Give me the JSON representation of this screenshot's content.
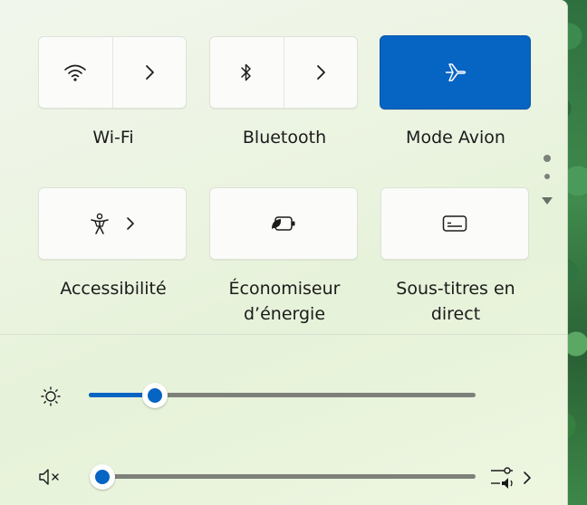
{
  "tiles": [
    {
      "id": "wifi",
      "label": "Wi-Fi",
      "icon": "wifi-icon",
      "active": false,
      "split": true
    },
    {
      "id": "bluetooth",
      "label": "Bluetooth",
      "icon": "bluetooth-icon",
      "active": false,
      "split": true
    },
    {
      "id": "airplane",
      "label": "Mode Avion",
      "icon": "airplane-icon",
      "active": true,
      "split": false
    },
    {
      "id": "accessibility",
      "label": "Accessibilité",
      "icon": "accessibility-icon",
      "active": false,
      "split": false
    },
    {
      "id": "energy",
      "label_line1": "Économiseur",
      "label_line2": "d’énergie",
      "icon": "battery-leaf-icon",
      "active": false,
      "split": false
    },
    {
      "id": "captions",
      "label_line1": "Sous-titres en",
      "label_line2": "direct",
      "icon": "captions-icon",
      "active": false,
      "split": false
    }
  ],
  "brightness": {
    "icon": "brightness-icon",
    "value_fraction": 0.17
  },
  "volume": {
    "icon": "volume-mute-icon",
    "value_fraction": 0.0,
    "settings_icon": "audio-output-settings-icon"
  },
  "colors": {
    "accent": "#0664c3",
    "track": "#7d817a"
  }
}
